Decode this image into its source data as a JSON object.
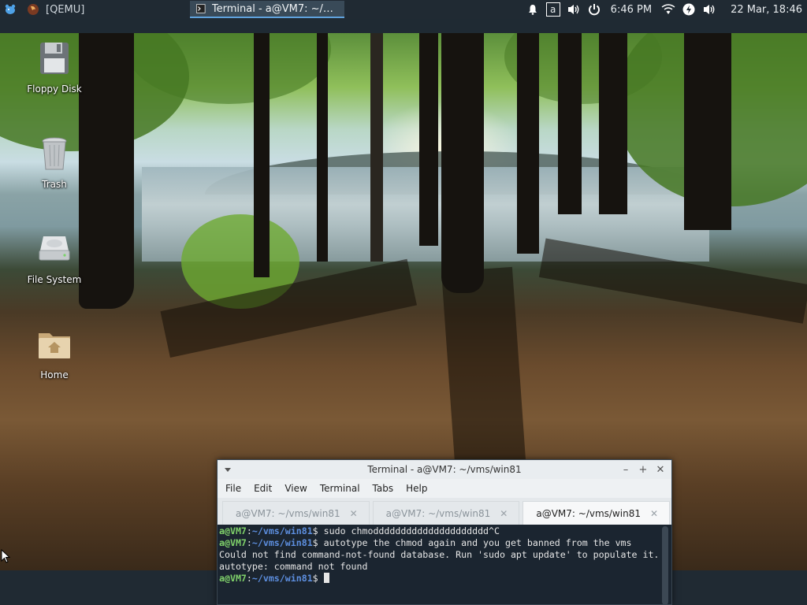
{
  "taskbar": {
    "qemu_label": "[QEMU]",
    "terminal_task_label": "Terminal - a@VM7: ~/vms/w...",
    "keyboard_layout": "a",
    "time": "6:46 PM",
    "datetime": "22 Mar, 18:46"
  },
  "desktop": {
    "icons": [
      {
        "label": "Floppy Disk"
      },
      {
        "label": "Trash"
      },
      {
        "label": "File System"
      },
      {
        "label": "Home"
      }
    ]
  },
  "terminal": {
    "title": "Terminal - a@VM7: ~/vms/win81",
    "menu": [
      "File",
      "Edit",
      "View",
      "Terminal",
      "Tabs",
      "Help"
    ],
    "tabs": [
      {
        "label": "a@VM7: ~/vms/win81",
        "active": false
      },
      {
        "label": "a@VM7: ~/vms/win81",
        "active": false
      },
      {
        "label": "a@VM7: ~/vms/win81",
        "active": true
      }
    ],
    "prompt_user": "a@VM7",
    "prompt_sep": ":",
    "prompt_path": "~/vms/win81",
    "prompt_end": "$ ",
    "lines": [
      {
        "type": "prompt",
        "cmd": "sudo chmoddddddddddddddddddddd^C"
      },
      {
        "type": "prompt",
        "cmd": "autotype the chmod again and you get banned from the vms"
      },
      {
        "type": "output",
        "text": "Could not find command-not-found database. Run 'sudo apt update' to populate it."
      },
      {
        "type": "output",
        "text": "autotype: command not found"
      },
      {
        "type": "prompt",
        "cmd": ""
      }
    ]
  },
  "colors": {
    "panel_bg": "#202a33",
    "prompt_user": "#7fd16a",
    "prompt_path": "#5d8fe0",
    "terminal_bg": "#1b2530"
  }
}
